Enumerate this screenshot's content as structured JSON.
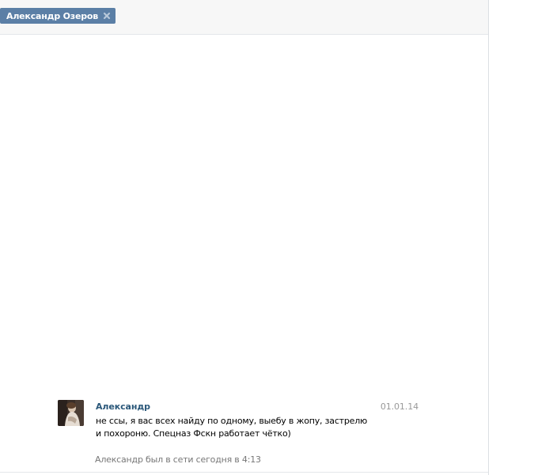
{
  "tabs": [
    {
      "label": "Александр Озеров",
      "close_icon": "close-icon",
      "color": "#5b7fa6"
    }
  ],
  "message": {
    "avatar_icon": "user-avatar-photo",
    "author": "Александр",
    "date": "01.01.14",
    "text": "не ссы, я вас всех найду по одному, выебу в жопу, застрелю и похороню. Спецназ Фскн работает чётко)"
  },
  "status": {
    "text": "Александр был в сети сегодня в 4:13"
  },
  "colors": {
    "accent": "#5b7fa6",
    "author": "#2b587a",
    "muted": "#999999"
  }
}
